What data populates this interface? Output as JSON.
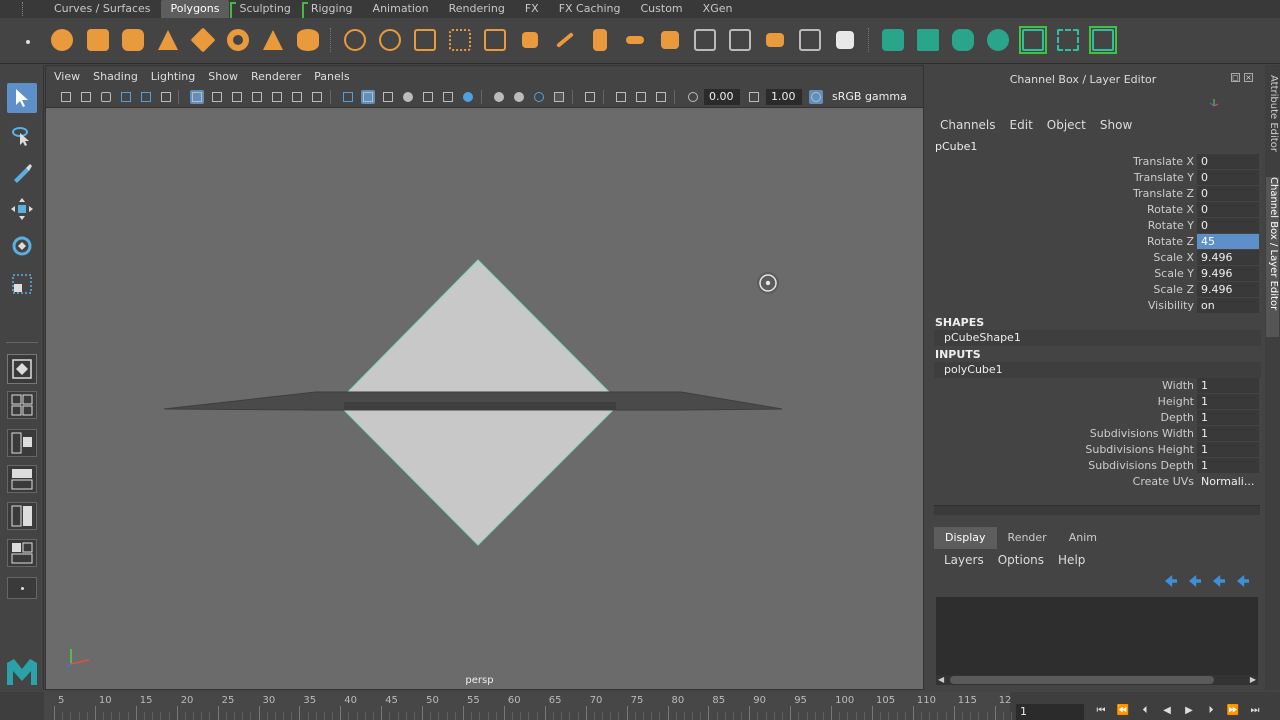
{
  "shelf": {
    "tabs": [
      {
        "label": "Curves / Surfaces"
      },
      {
        "label": "Polygons"
      },
      {
        "label": "Sculpting"
      },
      {
        "label": "Rigging"
      },
      {
        "label": "Animation"
      },
      {
        "label": "Rendering"
      },
      {
        "label": "FX"
      },
      {
        "label": "FX Caching"
      },
      {
        "label": "Custom"
      },
      {
        "label": "XGen"
      }
    ],
    "active_tab": "Polygons",
    "accent_color": "#e89a3c"
  },
  "viewport": {
    "menu": [
      "View",
      "Shading",
      "Lighting",
      "Show",
      "Renderer",
      "Panels"
    ],
    "exposure": "0.00",
    "gamma": "1.00",
    "color_space": "sRGB gamma",
    "camera_label": "persp"
  },
  "channel_box": {
    "title": "Channel Box / Layer Editor",
    "menu": [
      "Channels",
      "Edit",
      "Object",
      "Show"
    ],
    "object_name": "pCube1",
    "transform_attrs": [
      {
        "label": "Translate X",
        "value": "0"
      },
      {
        "label": "Translate Y",
        "value": "0"
      },
      {
        "label": "Translate Z",
        "value": "0"
      },
      {
        "label": "Rotate X",
        "value": "0"
      },
      {
        "label": "Rotate Y",
        "value": "0"
      },
      {
        "label": "Rotate Z",
        "value": "45"
      },
      {
        "label": "Scale X",
        "value": "9.496"
      },
      {
        "label": "Scale Y",
        "value": "9.496"
      },
      {
        "label": "Scale Z",
        "value": "9.496"
      },
      {
        "label": "Visibility",
        "value": "on"
      }
    ],
    "selected_attr": "Rotate Z",
    "shapes_header": "SHAPES",
    "shape_node": "pCubeShape1",
    "inputs_header": "INPUTS",
    "input_node": "polyCube1",
    "input_attrs": [
      {
        "label": "Width",
        "value": "1"
      },
      {
        "label": "Height",
        "value": "1"
      },
      {
        "label": "Depth",
        "value": "1"
      },
      {
        "label": "Subdivisions Width",
        "value": "1"
      },
      {
        "label": "Subdivisions Height",
        "value": "1"
      },
      {
        "label": "Subdivisions Depth",
        "value": "1"
      },
      {
        "label": "Create UVs",
        "value": "Normali..."
      }
    ]
  },
  "layer_editor": {
    "tabs": [
      "Display",
      "Render",
      "Anim"
    ],
    "active_tab": "Display",
    "menu": [
      "Layers",
      "Options",
      "Help"
    ]
  },
  "side_tabs": [
    "Attribute Editor",
    "Channel Box / Layer Editor"
  ],
  "time_slider": {
    "ticks": [
      "5",
      "10",
      "15",
      "20",
      "25",
      "30",
      "35",
      "40",
      "45",
      "50",
      "55",
      "60",
      "65",
      "70",
      "75",
      "80",
      "85",
      "90",
      "95",
      "100",
      "105",
      "110",
      "115",
      "12"
    ],
    "current_frame": "1"
  }
}
